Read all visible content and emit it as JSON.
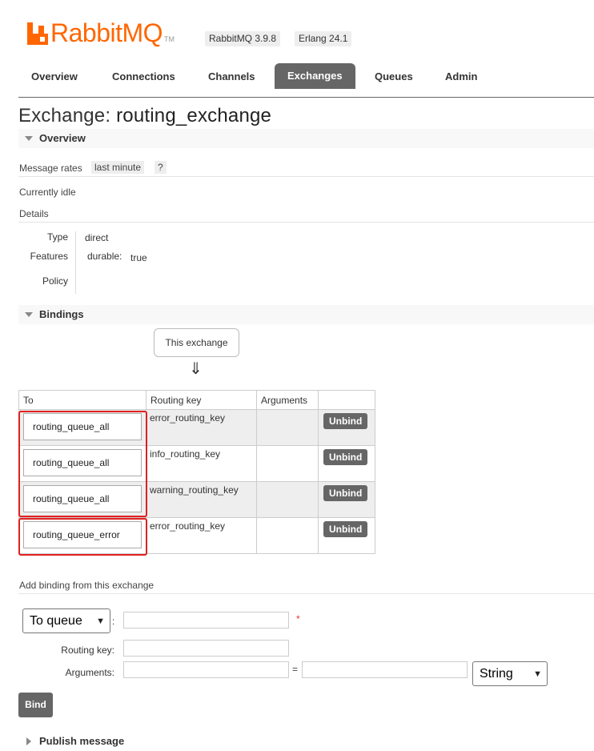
{
  "header": {
    "logo_text": "RabbitMQ",
    "logo_tm": "TM",
    "version_badge": "RabbitMQ 3.9.8",
    "erlang_badge": "Erlang 24.1"
  },
  "tabs": [
    {
      "label": "Overview"
    },
    {
      "label": "Connections"
    },
    {
      "label": "Channels"
    },
    {
      "label": "Exchanges"
    },
    {
      "label": "Queues"
    },
    {
      "label": "Admin"
    }
  ],
  "page": {
    "title_prefix": "Exchange:",
    "title_name": "routing_exchange"
  },
  "overview": {
    "header": "Overview",
    "message_rates_label": "Message rates",
    "message_rates_period": "last minute",
    "help": "?",
    "idle_text": "Currently idle",
    "details_label": "Details",
    "type_key": "Type",
    "type_value": "direct",
    "features_key": "Features",
    "features_name": "durable:",
    "features_value": "true",
    "policy_key": "Policy"
  },
  "bindings": {
    "header": "Bindings",
    "this_exchange": "This exchange",
    "arrow": "⇓",
    "columns": [
      "To",
      "Routing key",
      "Arguments",
      ""
    ],
    "rows": [
      {
        "to": "routing_queue_all",
        "routing_key": "error_routing_key",
        "action": "Unbind"
      },
      {
        "to": "routing_queue_all",
        "routing_key": "info_routing_key",
        "action": "Unbind"
      },
      {
        "to": "routing_queue_all",
        "routing_key": "warning_routing_key",
        "action": "Unbind"
      },
      {
        "to": "routing_queue_error",
        "routing_key": "error_routing_key",
        "action": "Unbind"
      }
    ]
  },
  "add_binding": {
    "header": "Add binding from this exchange",
    "destination_type": "To queue",
    "colon": ":",
    "required_mark": "*",
    "routing_key_label": "Routing key:",
    "arguments_label": "Arguments:",
    "equals": "=",
    "arg_type": "String",
    "bind_label": "Bind"
  },
  "publish": {
    "header": "Publish message"
  },
  "colors": {
    "brand": "#ff6600",
    "tab_active": "#666666",
    "highlight": "#e02020"
  }
}
